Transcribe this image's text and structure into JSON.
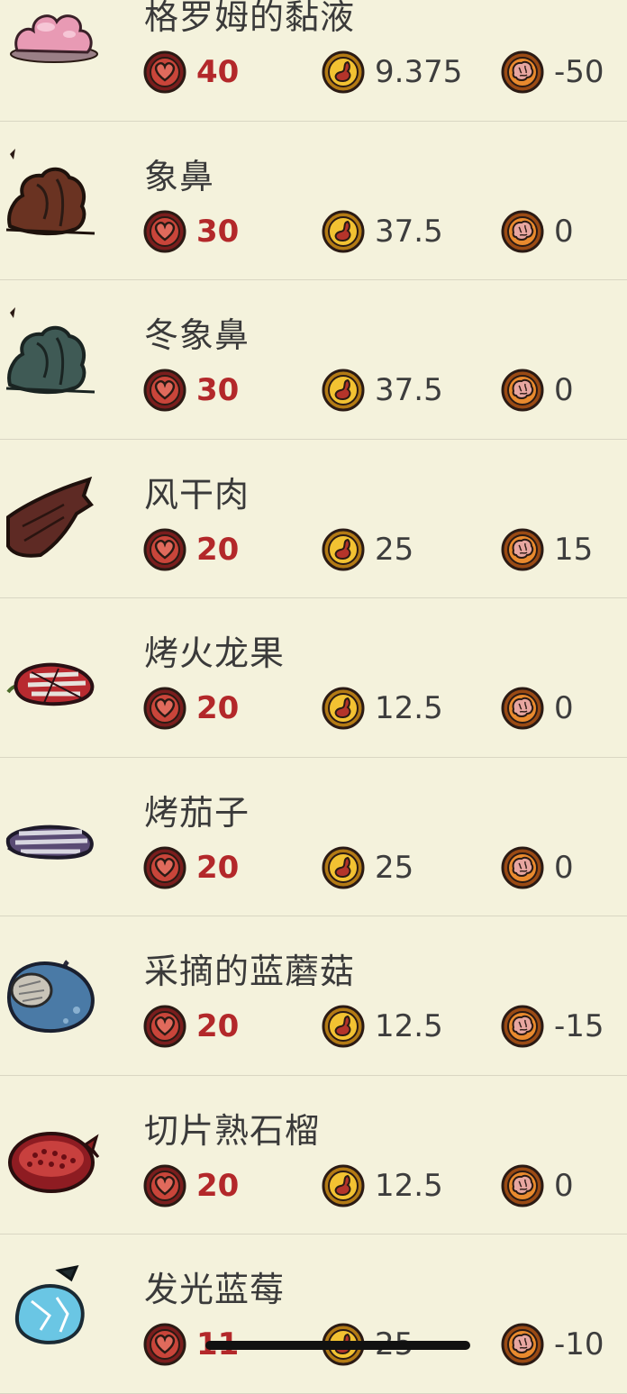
{
  "theme": {
    "background": "#f4f2dc",
    "divider": "#d9d6c3",
    "health_value_color": "#b3282a",
    "text_color": "#3a3a3a"
  },
  "stat_icons": {
    "health": "heart-icon",
    "hunger": "stomach-icon",
    "sanity": "brain-icon"
  },
  "foods": [
    {
      "name": "格罗姆的黏液",
      "icon": "glommer-goop-icon",
      "health": "40",
      "hunger": "9.375",
      "sanity": "-50"
    },
    {
      "name": "象鼻",
      "icon": "koalefant-trunk-icon",
      "health": "30",
      "hunger": "37.5",
      "sanity": "0"
    },
    {
      "name": "冬象鼻",
      "icon": "winter-koalefant-trunk-icon",
      "health": "30",
      "hunger": "37.5",
      "sanity": "0"
    },
    {
      "name": "风干肉",
      "icon": "jerky-icon",
      "health": "20",
      "hunger": "25",
      "sanity": "15"
    },
    {
      "name": "烤火龙果",
      "icon": "roasted-dragon-fruit-icon",
      "health": "20",
      "hunger": "12.5",
      "sanity": "0"
    },
    {
      "name": "烤茄子",
      "icon": "roasted-eggplant-icon",
      "health": "20",
      "hunger": "25",
      "sanity": "0"
    },
    {
      "name": "采摘的蓝蘑菇",
      "icon": "blue-cap-icon",
      "health": "20",
      "hunger": "12.5",
      "sanity": "-15"
    },
    {
      "name": "切片熟石榴",
      "icon": "cooked-pomegranate-icon",
      "health": "20",
      "hunger": "12.5",
      "sanity": "0"
    },
    {
      "name": "发光蓝莓",
      "icon": "glowberry-icon",
      "health": "11",
      "hunger": "25",
      "sanity": "-10"
    }
  ]
}
